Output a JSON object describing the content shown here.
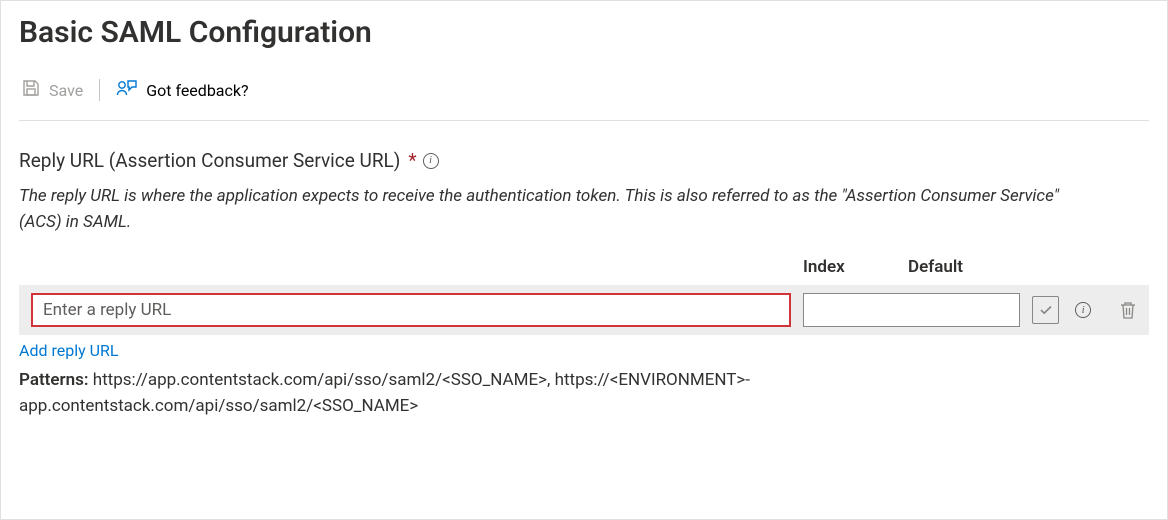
{
  "header": {
    "title": "Basic SAML Configuration"
  },
  "toolbar": {
    "save_label": "Save",
    "feedback_label": "Got feedback?"
  },
  "section": {
    "label": "Reply URL (Assertion Consumer Service URL)",
    "description": "The reply URL is where the application expects to receive the authentication token. This is also referred to as the \"Assertion Consumer Service\" (ACS) in SAML."
  },
  "columns": {
    "index": "Index",
    "default": "Default"
  },
  "row": {
    "url_value": "",
    "url_placeholder": "Enter a reply URL",
    "index_value": ""
  },
  "add_link_label": "Add reply URL",
  "patterns": {
    "label": "Patterns:",
    "text": "https://app.contentstack.com/api/sso/saml2/<SSO_NAME>, https://<ENVIRONMENT>-app.contentstack.com/api/sso/saml2/<SSO_NAME>"
  }
}
